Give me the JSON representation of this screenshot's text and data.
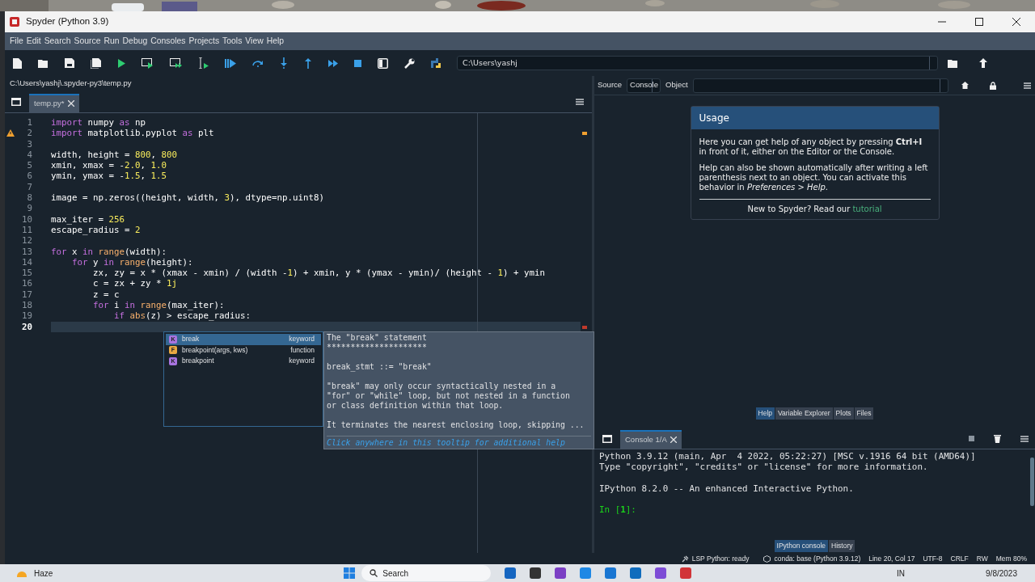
{
  "window": {
    "title": "Spyder (Python 3.9)"
  },
  "menu": [
    "File",
    "Edit",
    "Search",
    "Source",
    "Run",
    "Debug",
    "Consoles",
    "Projects",
    "Tools",
    "View",
    "Help"
  ],
  "working_directory": "C:\\Users\\yashj",
  "editor": {
    "path": "C:\\Users\\yashj\\.spyder-py3\\temp.py",
    "tabs": [
      {
        "label": "temp.py*",
        "selected": true
      }
    ],
    "lines": [
      {
        "number": "1",
        "warning": false,
        "current": false,
        "segments": [
          {
            "kind": "keyword",
            "text": "import"
          },
          {
            "kind": "plain",
            "text": " numpy "
          },
          {
            "kind": "keyword",
            "text": "as"
          },
          {
            "kind": "plain",
            "text": " np"
          }
        ]
      },
      {
        "number": "2",
        "warning": true,
        "current": false,
        "segments": [
          {
            "kind": "keyword",
            "text": "import"
          },
          {
            "kind": "plain",
            "text": " matplotlib.pyplot "
          },
          {
            "kind": "keyword",
            "text": "as"
          },
          {
            "kind": "plain",
            "text": " plt"
          }
        ]
      },
      {
        "number": "3",
        "warning": false,
        "current": false
      },
      {
        "number": "4",
        "warning": false,
        "current": false,
        "segments": [
          {
            "kind": "plain",
            "text": "width, height = "
          },
          {
            "kind": "number",
            "text": "800"
          },
          {
            "kind": "plain",
            "text": ", "
          },
          {
            "kind": "number",
            "text": "800"
          }
        ]
      },
      {
        "number": "5",
        "warning": false,
        "current": false,
        "segments": [
          {
            "kind": "plain",
            "text": "xmin, xmax = -"
          },
          {
            "kind": "number",
            "text": "2.0"
          },
          {
            "kind": "plain",
            "text": ", "
          },
          {
            "kind": "number",
            "text": "1.0"
          }
        ]
      },
      {
        "number": "6",
        "warning": false,
        "current": false,
        "segments": [
          {
            "kind": "plain",
            "text": "ymin, ymax = -"
          },
          {
            "kind": "number",
            "text": "1.5"
          },
          {
            "kind": "plain",
            "text": ", "
          },
          {
            "kind": "number",
            "text": "1.5"
          }
        ]
      },
      {
        "number": "7",
        "warning": false,
        "current": false
      },
      {
        "number": "8",
        "warning": false,
        "current": false,
        "segments": [
          {
            "kind": "plain",
            "text": "image = np.zeros((height, width, "
          },
          {
            "kind": "number",
            "text": "3"
          },
          {
            "kind": "plain",
            "text": "), dtype=np.uint8)"
          }
        ]
      },
      {
        "number": "9",
        "warning": false,
        "current": false
      },
      {
        "number": "10",
        "warning": false,
        "current": false,
        "segments": [
          {
            "kind": "plain",
            "text": "max_iter = "
          },
          {
            "kind": "number",
            "text": "256"
          }
        ]
      },
      {
        "number": "11",
        "warning": false,
        "current": false,
        "segments": [
          {
            "kind": "plain",
            "text": "escape_radius = "
          },
          {
            "kind": "number",
            "text": "2"
          }
        ]
      },
      {
        "number": "12",
        "warning": false,
        "current": false
      },
      {
        "number": "13",
        "warning": false,
        "current": false,
        "segments": [
          {
            "kind": "keyword",
            "text": "for"
          },
          {
            "kind": "plain",
            "text": " x "
          },
          {
            "kind": "keyword",
            "text": "in"
          },
          {
            "kind": "builtin",
            "text": " range"
          },
          {
            "kind": "plain",
            "text": "(width):"
          }
        ]
      },
      {
        "number": "14",
        "warning": false,
        "current": false,
        "segments": [
          {
            "kind": "keyword",
            "text": "    for"
          },
          {
            "kind": "plain",
            "text": " y "
          },
          {
            "kind": "keyword",
            "text": "in"
          },
          {
            "kind": "builtin",
            "text": " range"
          },
          {
            "kind": "plain",
            "text": "(height):"
          }
        ]
      },
      {
        "number": "15",
        "warning": false,
        "current": false,
        "segments": [
          {
            "kind": "plain",
            "text": "        zx, zy = x * (xmax - xmin) / (width -"
          },
          {
            "kind": "number",
            "text": "1"
          },
          {
            "kind": "plain",
            "text": ") + xmin, y * (ymax - ymin)/ (height - "
          },
          {
            "kind": "number",
            "text": "1"
          },
          {
            "kind": "plain",
            "text": ") + ymin"
          }
        ]
      },
      {
        "number": "16",
        "warning": false,
        "current": false,
        "segments": [
          {
            "kind": "plain",
            "text": "        c = zx + zy * "
          },
          {
            "kind": "number",
            "text": "1j"
          }
        ]
      },
      {
        "number": "17",
        "warning": false,
        "current": false,
        "segments": [
          {
            "kind": "plain",
            "text": "        z = c"
          }
        ]
      },
      {
        "number": "18",
        "warning": false,
        "current": false,
        "segments": [
          {
            "kind": "keyword",
            "text": "        for"
          },
          {
            "kind": "plain",
            "text": " i "
          },
          {
            "kind": "keyword",
            "text": "in"
          },
          {
            "kind": "builtin",
            "text": " range"
          },
          {
            "kind": "plain",
            "text": "(max_iter):"
          }
        ]
      },
      {
        "number": "19",
        "warning": false,
        "current": false,
        "segments": [
          {
            "kind": "keyword",
            "text": "            if"
          },
          {
            "kind": "builtin",
            "text": " abs"
          },
          {
            "kind": "plain",
            "text": "(z) > escape_radius:"
          }
        ]
      },
      {
        "number": "20",
        "warning": false,
        "current": true
      }
    ],
    "completions": [
      {
        "badge": "K",
        "color": "#a874e0",
        "label": "break",
        "type": "keyword",
        "selected": true
      },
      {
        "badge": "F",
        "color": "#e8a840",
        "label": "breakpoint(args, kws)",
        "type": "function",
        "selected": false
      },
      {
        "badge": "K",
        "color": "#a874e0",
        "label": "breakpoint",
        "type": "keyword",
        "selected": false
      }
    ],
    "tooltip": {
      "title": "The \"break\" statement",
      "title_rule": "*********************",
      "paragraphs": [
        "break_stmt ::= \"break\"",
        "\"break\" may only occur syntactically nested in a\n\"for\" or \"while\" loop, but not nested in a function\nor class definition within that loop.",
        "It terminates the nearest enclosing loop, skipping ..."
      ],
      "footer": "Click anywhere in this tooltip for additional help"
    }
  },
  "help": {
    "source_label": "Source",
    "source_value": "Console",
    "object_label": "Object",
    "card_title": "Usage",
    "paragraphs": [
      "Here you can get help of any object by pressing **Ctrl+I** in front of it, either on the Editor or the Console.",
      "Help can also be shown automatically after writing a left parenthesis next to an object. You can activate this behavior in *Preferences > Help*."
    ],
    "prompt": "New to Spyder? Read our",
    "link": "tutorial",
    "tabs": [
      {
        "label": "Help",
        "selected": true
      },
      {
        "label": "Variable Explorer",
        "selected": false
      },
      {
        "label": "Plots",
        "selected": false
      },
      {
        "label": "Files",
        "selected": false
      }
    ]
  },
  "console": {
    "tabs": [
      {
        "label": "Console 1/A",
        "selected": true
      }
    ],
    "banner": [
      "Python 3.9.12 (main, Apr  4 2022, 05:22:27) [MSC v.1916 64 bit (AMD64)]\nType \"copyright\", \"credits\" or \"license\" for more information.",
      "IPython 8.2.0 -- An enhanced Interactive Python."
    ],
    "prompt": "In [**1**]:",
    "bottom_tabs": [
      {
        "label": "IPython console",
        "selected": true
      },
      {
        "label": "History",
        "selected": false
      }
    ]
  },
  "status_bar": {
    "lsp": "LSP Python: ready",
    "conda": "conda: base (Python 3.9.12)",
    "position": "Line 20, Col 17",
    "encoding": "UTF-8",
    "eol": "CRLF",
    "permissions": "RW",
    "memory": "Mem 80%"
  },
  "taskbar": {
    "weather": "Haze",
    "search": "Search",
    "language": "IN",
    "date": "9/8/2023"
  }
}
